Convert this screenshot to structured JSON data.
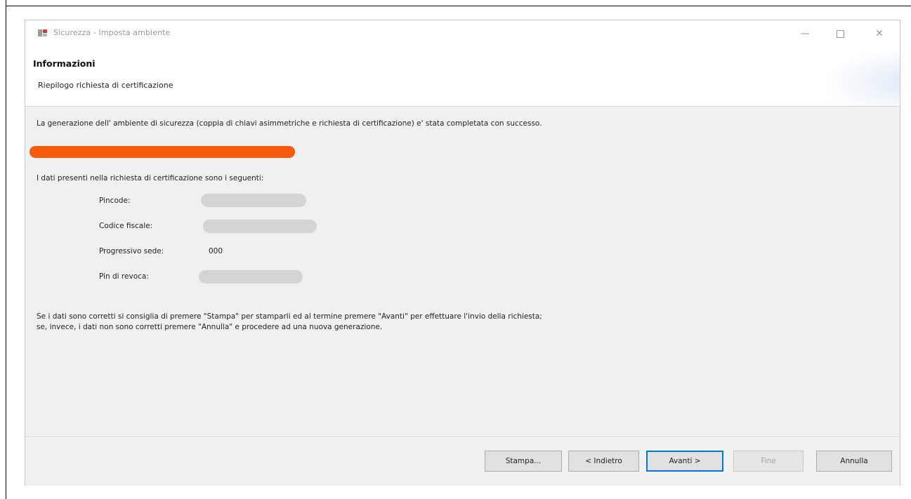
{
  "window": {
    "title": "Sicurezza - Imposta ambiente",
    "controls": {
      "minimize": "—",
      "close": "✕"
    }
  },
  "header": {
    "title": "Informazioni",
    "subtitle": "Riepilogo richiesta di certificazione"
  },
  "content": {
    "intro": "La generazione  dell' ambiente  di sicurezza (coppia di chiavi asimmetriche e richiesta di certificazione) e' stata completata con successo.",
    "list_intro": "I dati presenti nella richiesta di certificazione sono i seguenti:",
    "fields": [
      {
        "label": "Pincode:",
        "value": ""
      },
      {
        "label": "Codice fiscale:",
        "value": ""
      },
      {
        "label": "Progressivo sede:",
        "value": "000"
      },
      {
        "label": "Pin di revoca:",
        "value": ""
      }
    ],
    "bottom_line1": "Se i dati sono corretti si consiglia di premere \"Stampa\" per stamparli ed al termine premere \"Avanti\" per effettuare l'invio della richiesta;",
    "bottom_line2": "se, invece, i dati non sono corretti premere \"Annulla\" e procedere ad una nuova generazione."
  },
  "buttons": {
    "stampa": "Stampa...",
    "indietro": "< Indietro",
    "avanti": "Avanti >",
    "fine": "Fine",
    "annulla": "Annulla"
  },
  "colors": {
    "redaction": "#f55a0c",
    "default_button_border": "#0078d7"
  }
}
